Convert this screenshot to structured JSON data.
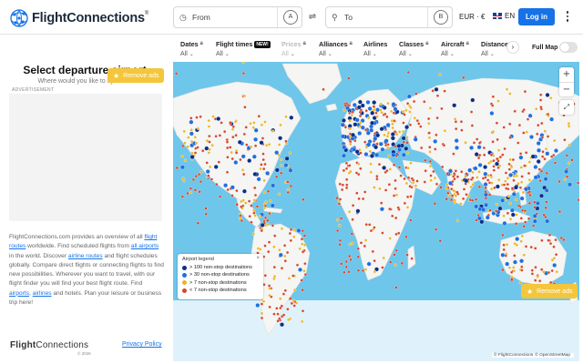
{
  "brand": {
    "name": "FlightConnections",
    "reg": "®"
  },
  "search": {
    "from_placeholder": "From",
    "to_placeholder": "To",
    "from_badge": "A",
    "to_badge": "B",
    "swap": "⇄"
  },
  "header": {
    "currency": "EUR · €",
    "language": "EN",
    "login_label": "Log in"
  },
  "sidebar": {
    "title": "Select departure airport",
    "subtitle": "Where would you like to fly from?",
    "remove_ads": "Remove ads",
    "ad_label": "ADVERTISEMENT",
    "about": {
      "t1": "FlightConnections.com provides an overview of all ",
      "l1": "flight routes",
      "t2": " worldwide. Find scheduled flights from ",
      "l2": "all airports",
      "t3": " in the world. Discover ",
      "l3": "airline routes",
      "t4": " and flight schedules globally. Compare direct flights or connecting flights to find new possibilities. Wherever you want to travel, with our flight finder you will find your best flight route. Find ",
      "l4": "airports",
      "t5": ", ",
      "l5": "airlines",
      "t6": " and hotels. Plan your leisure or business trip here!"
    },
    "footer_logo_bold": "Flight",
    "footer_logo_light": "Connections",
    "footer_copy": "© 2026",
    "privacy": "Privacy Policy"
  },
  "filters": [
    {
      "label": "Dates",
      "value": "All",
      "lock": true,
      "disabled": false
    },
    {
      "label": "Flight times",
      "value": "All",
      "badge": "NEW!",
      "disabled": false
    },
    {
      "label": "Prices",
      "value": "All",
      "lock": true,
      "disabled": true
    },
    {
      "label": "Alliances",
      "value": "All",
      "lock": true,
      "disabled": false
    },
    {
      "label": "Airlines",
      "value": "All",
      "disabled": false
    },
    {
      "label": "Classes",
      "value": "All",
      "lock": true,
      "disabled": false
    },
    {
      "label": "Aircraft",
      "value": "All",
      "lock": true,
      "disabled": false
    },
    {
      "label": "Distance",
      "value": "All",
      "disabled": false
    }
  ],
  "full_map_label": "Full Map",
  "map": {
    "zoom_in": "+",
    "zoom_out": "−",
    "remove_ads": "Remove ads",
    "attribution_1": "© FlightConnections",
    "attribution_2": "© OpenStreetMap",
    "colors": {
      "ocean": "#6ec6ea",
      "land": "#f5f5f3",
      "ice": "#dff2fb"
    }
  },
  "legend": {
    "title": "Airport legend",
    "close": "×",
    "items": [
      {
        "label": "> 100 non-stop destinations",
        "color": "#0b2f87"
      },
      {
        "label": "> 30 non-stop destinations",
        "color": "#1f6fe0"
      },
      {
        "label": "> 7 non-stop destinations",
        "color": "#e9b620"
      },
      {
        "label": "< 7 non-stop destinations",
        "color": "#d4452b"
      }
    ]
  }
}
